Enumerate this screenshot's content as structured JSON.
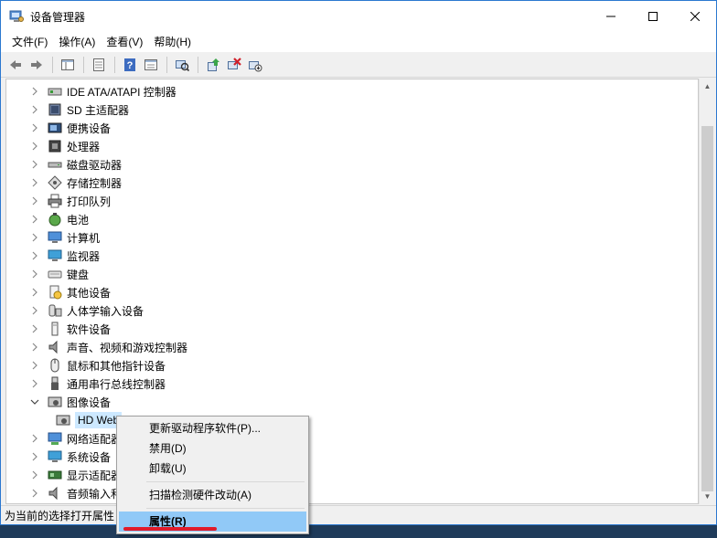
{
  "window": {
    "title": "设备管理器"
  },
  "menubar": [
    {
      "label": "文件(F)"
    },
    {
      "label": "操作(A)"
    },
    {
      "label": "查看(V)"
    },
    {
      "label": "帮助(H)"
    }
  ],
  "toolbar": [
    {
      "icon": "back-arrow-icon"
    },
    {
      "icon": "forward-arrow-icon"
    },
    {
      "icon": "show-hide-console-tree-icon"
    },
    {
      "icon": "properties-icon"
    },
    {
      "icon": "help-icon"
    },
    {
      "icon": "view-icon"
    },
    {
      "icon": "scan-hardware-icon"
    },
    {
      "icon": "update-driver-icon"
    },
    {
      "icon": "uninstall-device-icon"
    },
    {
      "icon": "disable-device-icon"
    }
  ],
  "tree": {
    "rows": [
      {
        "label": "IDE ATA/ATAPI 控制器",
        "icon": "ide-controller-icon",
        "expander": "collapsed"
      },
      {
        "label": "SD 主适配器",
        "icon": "sd-adapter-icon",
        "expander": "collapsed"
      },
      {
        "label": "便携设备",
        "icon": "portable-device-icon",
        "expander": "collapsed"
      },
      {
        "label": "处理器",
        "icon": "processor-icon",
        "expander": "collapsed"
      },
      {
        "label": "磁盘驱动器",
        "icon": "disk-drive-icon",
        "expander": "collapsed"
      },
      {
        "label": "存储控制器",
        "icon": "storage-controller-icon",
        "expander": "collapsed"
      },
      {
        "label": "打印队列",
        "icon": "printer-icon",
        "expander": "collapsed"
      },
      {
        "label": "电池",
        "icon": "battery-icon",
        "expander": "collapsed"
      },
      {
        "label": "计算机",
        "icon": "computer-icon",
        "expander": "collapsed"
      },
      {
        "label": "监视器",
        "icon": "monitor-icon",
        "expander": "collapsed"
      },
      {
        "label": "键盘",
        "icon": "keyboard-icon",
        "expander": "collapsed"
      },
      {
        "label": "其他设备",
        "icon": "other-device-icon",
        "expander": "collapsed"
      },
      {
        "label": "人体学输入设备",
        "icon": "hid-icon",
        "expander": "collapsed"
      },
      {
        "label": "软件设备",
        "icon": "software-device-icon",
        "expander": "collapsed"
      },
      {
        "label": "声音、视频和游戏控制器",
        "icon": "sound-icon",
        "expander": "collapsed"
      },
      {
        "label": "鼠标和其他指针设备",
        "icon": "mouse-icon",
        "expander": "collapsed"
      },
      {
        "label": "通用串行总线控制器",
        "icon": "usb-icon",
        "expander": "collapsed"
      },
      {
        "label": "图像设备",
        "icon": "imaging-device-icon",
        "expander": "expanded"
      },
      {
        "label": "HD Web",
        "icon": "webcam-icon",
        "expander": "none",
        "child": true,
        "selected": true
      },
      {
        "label": "网络适配器",
        "icon": "network-adapter-icon",
        "expander": "collapsed"
      },
      {
        "label": "系统设备",
        "icon": "system-device-icon",
        "expander": "collapsed"
      },
      {
        "label": "显示适配器",
        "icon": "display-adapter-icon",
        "expander": "collapsed"
      },
      {
        "label": "音频输入和",
        "icon": "audio-io-icon",
        "expander": "collapsed"
      }
    ]
  },
  "statusbar": {
    "text": "为当前的选择打开属性"
  },
  "context_menu": {
    "items": [
      {
        "label": "更新驱动程序软件(P)..."
      },
      {
        "label": "禁用(D)"
      },
      {
        "label": "卸载(U)"
      },
      {
        "label": "扫描检测硬件改动(A)"
      },
      {
        "label": "属性(R)",
        "highlighted": true
      }
    ]
  },
  "colors": {
    "highlight": "#91c9f7",
    "selection": "#cce8ff",
    "annotation_underline": "#e11b2a",
    "window_border": "#2b78d0"
  }
}
